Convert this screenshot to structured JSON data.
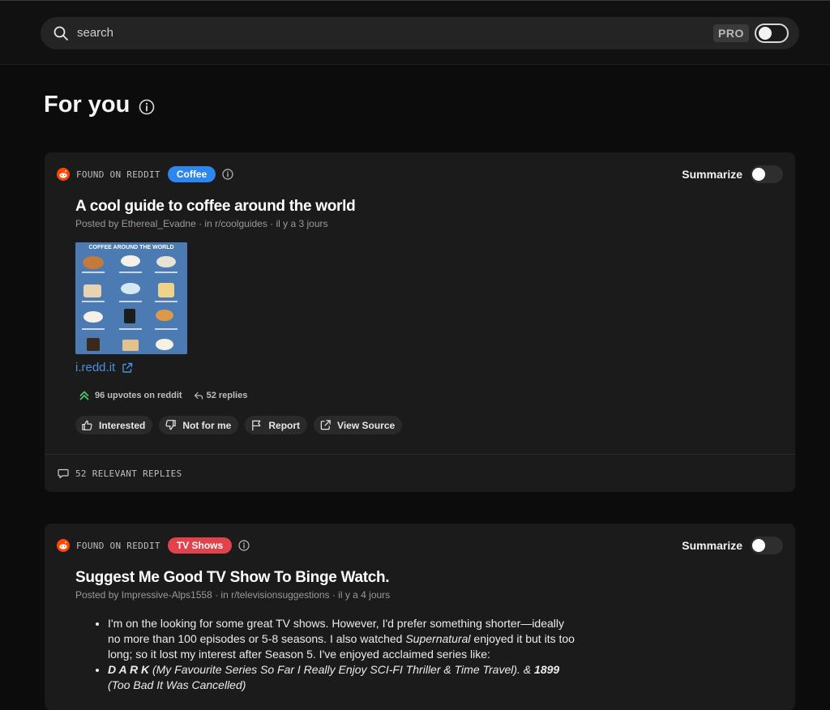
{
  "search": {
    "placeholder": "search",
    "pro_label": "PRO"
  },
  "page": {
    "title": "For you"
  },
  "posts": [
    {
      "source_label": "FOUND ON REDDIT",
      "tag": "Coffee",
      "tag_color": "#2e86f0",
      "summarize_label": "Summarize",
      "title": "A cool guide to coffee around the world",
      "meta": "Posted by Ethereal_Evadne · in r/coolguides · il y a 3 jours",
      "thumbnail_text": "COFFEE AROUND THE WORLD",
      "link": "i.redd.it",
      "upvotes": "96 upvotes on reddit",
      "replies": "52 replies",
      "actions": [
        "Interested",
        "Not for me",
        "Report",
        "View Source"
      ],
      "relevant_replies": "52 RELEVANT REPLIES"
    },
    {
      "source_label": "FOUND ON REDDIT",
      "tag": "TV Shows",
      "tag_color": "#e0434b",
      "summarize_label": "Summarize",
      "title": "Suggest Me Good TV Show To Binge Watch.",
      "meta": "Posted by Impressive-Alps1558 · in r/televisionsuggestions · il y a 4 jours",
      "body": {
        "item1_a": "I'm on the looking for some great TV shows. However, I'd prefer something shorter—ideally no more than 100 episodes or 5-8 seasons. I also watched ",
        "item1_italic": "Supernatural",
        "item1_b": " enjoyed it but its too long; so it lost my interest after Season 5. I've enjoyed acclaimed series like:",
        "item2_bold": "D A R K",
        "item2_italic": " (My Favourite Series So Far I Really Enjoy SCI-FI Thriller & Time Travel).",
        "item2_amp": " & ",
        "item2_bold2": "1899",
        "item2_italic2": " (Too Bad It Was Cancelled)"
      }
    }
  ]
}
